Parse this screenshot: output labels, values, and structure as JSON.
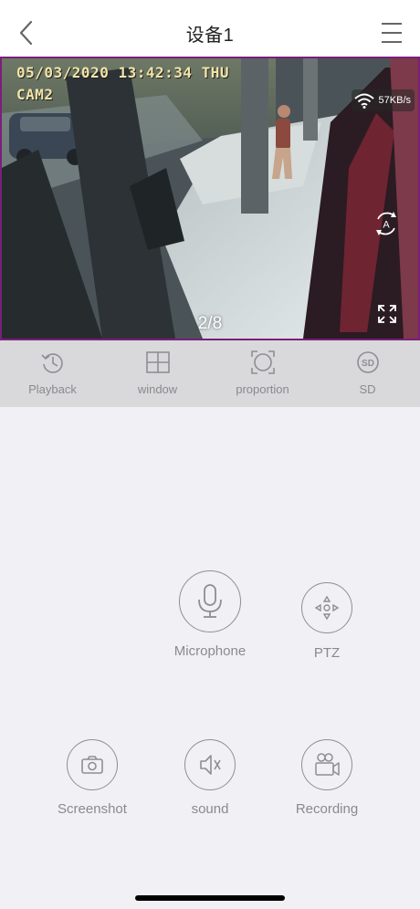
{
  "nav": {
    "title": "设备1",
    "back_icon": "chevron-left-icon",
    "menu_icon": "hamburger-menu-icon"
  },
  "video": {
    "osd_datetime": "05/03/2020 13:42:34 THU",
    "osd_camera": "CAM2",
    "speed": "57KB/s",
    "page_indicator": "2/8",
    "border_color": "#7a1f7c"
  },
  "toolbar": {
    "items": [
      {
        "label": "Playback",
        "icon": "history-clock-icon"
      },
      {
        "label": "window",
        "icon": "grid-window-icon"
      },
      {
        "label": "proportion",
        "icon": "aspect-ratio-icon"
      },
      {
        "label": "SD",
        "icon": "sd-card-icon"
      }
    ]
  },
  "controls": {
    "microphone": "Microphone",
    "ptz": "PTZ",
    "screenshot": "Screenshot",
    "sound": "sound",
    "recording": "Recording"
  },
  "colors": {
    "background": "#f1f1f5",
    "toolbar_bg": "#d9d9dc",
    "icon_gray": "#8e8e93"
  }
}
